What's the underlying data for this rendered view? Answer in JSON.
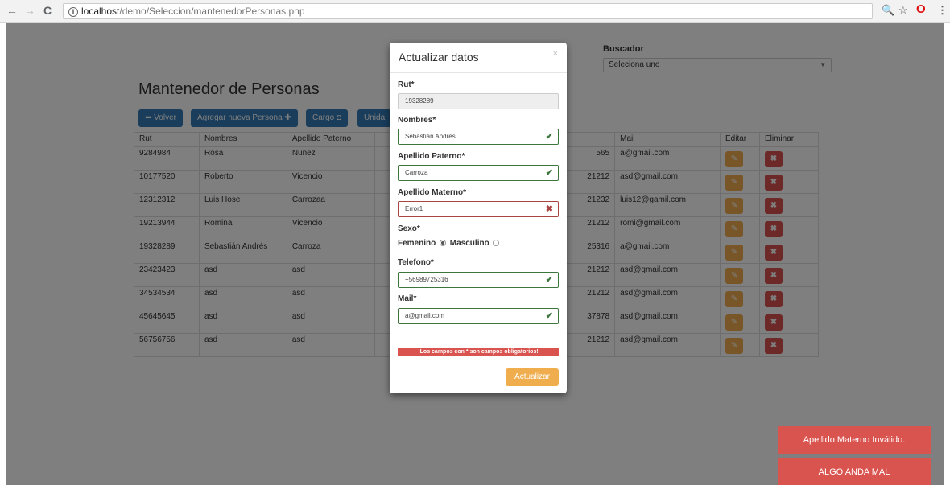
{
  "browser": {
    "host": "localhost",
    "path": "/demo/Seleccion/mantenedorPersonas.php"
  },
  "page": {
    "title": "Mantenedor de Personas",
    "buttons": {
      "volver": "Volver",
      "agregar": "Agregar nueva Persona",
      "cargo": "Cargo",
      "unidad": "Unida"
    },
    "buscador": {
      "label": "Buscador",
      "selected": "Seleciona uno"
    },
    "table": {
      "headers": [
        "Rut",
        "Nombres",
        "Apellido Paterno",
        "",
        "",
        "Mail",
        "Editar",
        "Eliminar"
      ],
      "rows": [
        {
          "rut": "9284984",
          "nombres": "Rosa",
          "ap": "Nunez",
          "tel": "565",
          "mail": "a@gmail.com"
        },
        {
          "rut": "10177520",
          "nombres": "Roberto",
          "ap": "Vicencio",
          "tel": "21212",
          "mail": "asd@gmail.com"
        },
        {
          "rut": "12312312",
          "nombres": "Luis Hose",
          "ap": "Carrozaa",
          "tel": "21232",
          "mail": "luis12@gamil.com"
        },
        {
          "rut": "19213944",
          "nombres": "Romina",
          "ap": "Vicencio",
          "tel": "21212",
          "mail": "romi@gmail.com"
        },
        {
          "rut": "19328289",
          "nombres": "Sebastián Andrés",
          "ap": "Carroza",
          "tel": "25316",
          "mail": "a@gmail.com"
        },
        {
          "rut": "23423423",
          "nombres": "asd",
          "ap": "asd",
          "tel": "21212",
          "mail": "asd@gmail.com"
        },
        {
          "rut": "34534534",
          "nombres": "asd",
          "ap": "asd",
          "tel": "21212",
          "mail": "asd@gmail.com"
        },
        {
          "rut": "45645645",
          "nombres": "asd",
          "ap": "asd",
          "tel": "37878",
          "mail": "asd@gmail.com"
        },
        {
          "rut": "56756756",
          "nombres": "asd",
          "ap": "asd",
          "tel": "21212",
          "mail": "asd@gmail.com"
        }
      ]
    }
  },
  "modal": {
    "title": "Actualizar datos",
    "close": "×",
    "rut_label": "Rut*",
    "rut_value": "19328289",
    "nombres_label": "Nombres*",
    "nombres_value": "Sebastián Andrés",
    "ap_label": "Apellido Paterno*",
    "ap_value": "Carroza",
    "am_label": "Apellido Materno*",
    "am_value": "Error1",
    "sexo_label": "Sexo*",
    "femenino": "Femenino",
    "masculino": "Masculino",
    "tel_label": "Telefono*",
    "tel_value": "+56989725316",
    "mail_label": "Mail*",
    "mail_value": "a@gmail.com",
    "required_note": "¡Los campos con * son campos obligatorios!",
    "submit": "Actualizar"
  },
  "toasts": {
    "error1": "Apellido Materno Inválido.",
    "error2": "ALGO ANDA MAL"
  },
  "colors": {
    "primary": "#337ab7",
    "warning": "#f0ad4e",
    "danger": "#d9534f",
    "success": "#3c763d"
  }
}
